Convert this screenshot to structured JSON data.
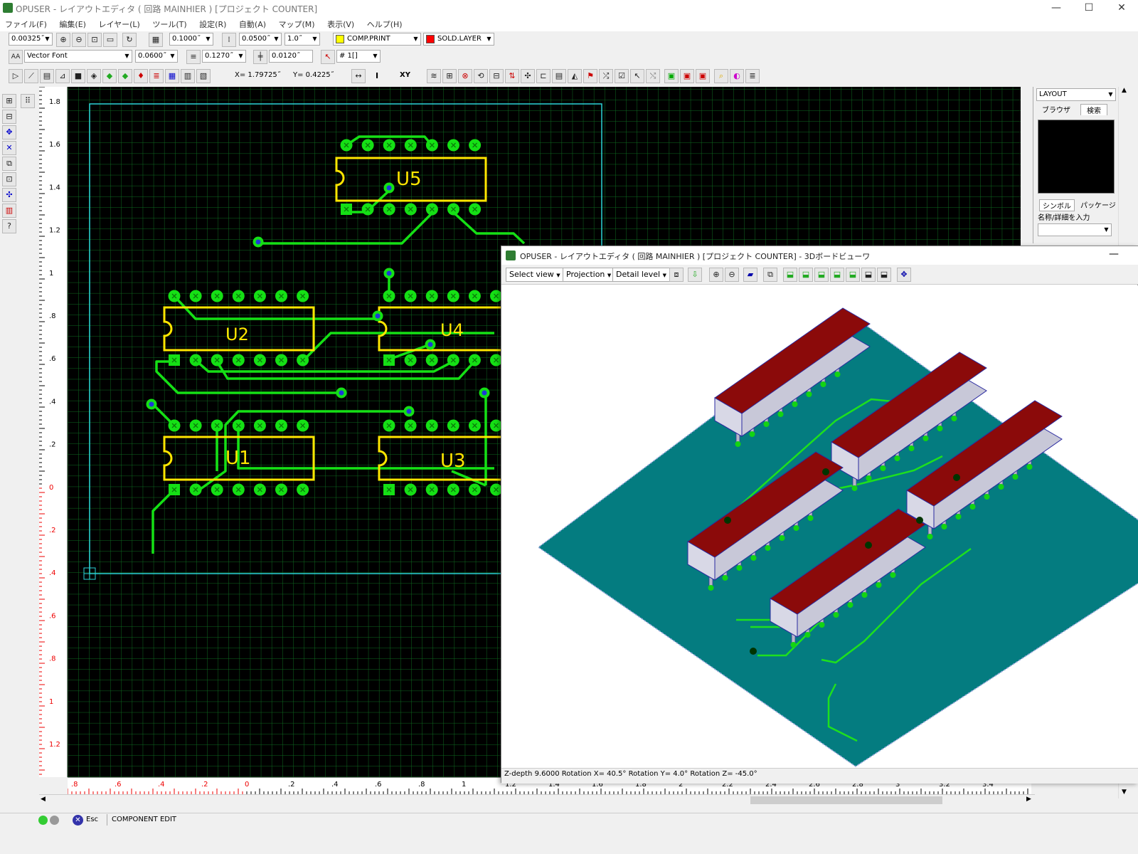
{
  "window": {
    "title": "OPUSER - レイアウトエディタ ( 回路 MAINHIER ) [プロジェクト COUNTER]",
    "min": "—",
    "max": "☐",
    "close": "✕"
  },
  "menu": [
    "ファイル(F)",
    "編集(E)",
    "レイヤー(L)",
    "ツール(T)",
    "設定(R)",
    "自動(A)",
    "マップ(M)",
    "表示(V)",
    "ヘルプ(H)"
  ],
  "toolbar1": {
    "step": "0.00325˝",
    "grid": "0.1000˝",
    "snap": "0.0500˝",
    "scale": "1.0˝",
    "comp_layer": "COMP.PRINT",
    "comp_color": "#ffff00",
    "sold_layer": "SOLD.LAYER",
    "sold_color": "#ff0000"
  },
  "toolbar2": {
    "font": "Vector Font",
    "font_size": "0.0600˝",
    "width": "0.1270˝",
    "clearance": "0.0120˝",
    "net": "# 1[]"
  },
  "toolbar3": {
    "x": "X= 1.79725˝",
    "y": "Y= 0.4225˝",
    "i_label": "I",
    "xy_label": "XY"
  },
  "side_panel": {
    "layout": "LAYOUT",
    "tab_browser": "ブラウザ",
    "tab_search": "検索",
    "tab_symbol": "シンボル",
    "tab_package": "パッケージ",
    "name_label": "名称/詳細を入力"
  },
  "vruler": [
    {
      "v": "1.8",
      "c": "b"
    },
    {
      "v": "1.6",
      "c": "b"
    },
    {
      "v": "1.4",
      "c": "b"
    },
    {
      "v": "1.2",
      "c": "b"
    },
    {
      "v": "1",
      "c": "b"
    },
    {
      "v": ".8",
      "c": "b"
    },
    {
      "v": ".6",
      "c": "b"
    },
    {
      "v": ".4",
      "c": "b"
    },
    {
      "v": ".2",
      "c": "b"
    },
    {
      "v": "0",
      "c": "r"
    },
    {
      "v": ".2",
      "c": "r"
    },
    {
      "v": ".4",
      "c": "r"
    },
    {
      "v": ".6",
      "c": "r"
    },
    {
      "v": ".8",
      "c": "r"
    },
    {
      "v": "1",
      "c": "r"
    },
    {
      "v": "1.2",
      "c": "r"
    }
  ],
  "hruler": [
    {
      "v": ".8",
      "c": "r"
    },
    {
      "v": ".6",
      "c": "r"
    },
    {
      "v": ".4",
      "c": "r"
    },
    {
      "v": ".2",
      "c": "r"
    },
    {
      "v": "0",
      "c": "r"
    },
    {
      "v": ".2",
      "c": "b"
    },
    {
      "v": ".4",
      "c": "b"
    },
    {
      "v": ".6",
      "c": "b"
    },
    {
      "v": ".8",
      "c": "b"
    },
    {
      "v": "1",
      "c": "b"
    },
    {
      "v": "1.2",
      "c": "b"
    },
    {
      "v": "1.4",
      "c": "b"
    },
    {
      "v": "1.6",
      "c": "b"
    },
    {
      "v": "1.8",
      "c": "b"
    },
    {
      "v": "2",
      "c": "b"
    },
    {
      "v": "2.2",
      "c": "b"
    },
    {
      "v": "2.4",
      "c": "b"
    },
    {
      "v": "2.6",
      "c": "b"
    },
    {
      "v": "2.8",
      "c": "b"
    },
    {
      "v": "3",
      "c": "b"
    },
    {
      "v": "3.2",
      "c": "b"
    },
    {
      "v": "3.4",
      "c": "b"
    }
  ],
  "components": [
    {
      "ref": "U5"
    },
    {
      "ref": "U2"
    },
    {
      "ref": "U4"
    },
    {
      "ref": "U1"
    },
    {
      "ref": "U3"
    }
  ],
  "status": {
    "esc": "Esc",
    "mode": "COMPONENT EDIT"
  },
  "viewer3d": {
    "title": "OPUSER - レイアウトエディタ ( 回路 MAINHIER ) [プロジェクト COUNTER] - 3Dボードビューワ",
    "select_view": "Select view",
    "projection": "Projection",
    "detail_level": "Detail level",
    "status": "Z-depth 9.6000   Rotation X= 40.5°   Rotation Y= 4.0°   Rotation Z= -45.0°",
    "min": "—"
  }
}
